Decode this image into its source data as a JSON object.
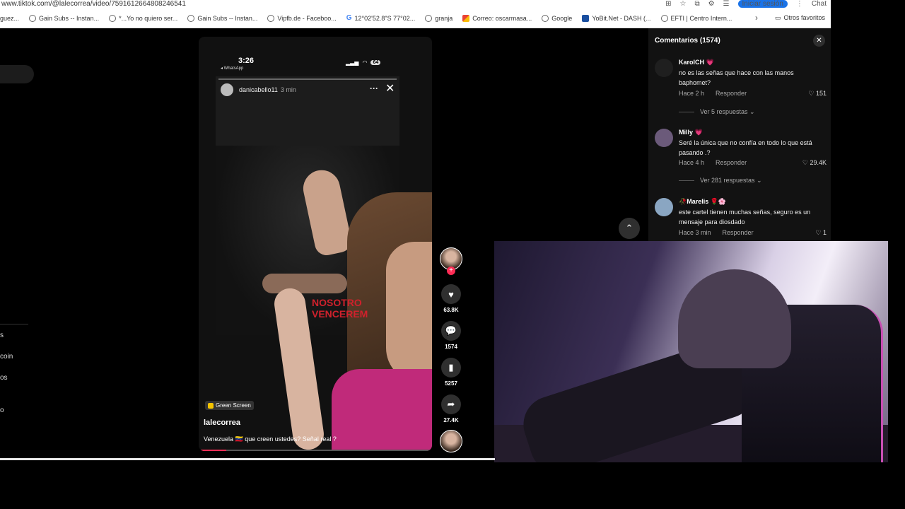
{
  "browser": {
    "url": "www.tiktok.com/@lalecorrea/video/7591612664808246541",
    "login_label": "Iniciar sesión",
    "chat_label": "Chat",
    "bookmarks": [
      {
        "label": "guez...",
        "icon": "none"
      },
      {
        "label": "Gain Subs -- Instan...",
        "icon": "globe-icon"
      },
      {
        "label": "*...Yo no quiero ser...",
        "icon": "tiktok-icon"
      },
      {
        "label": "Gain Subs -- Instan...",
        "icon": "globe-icon"
      },
      {
        "label": "Vipfb.de - Faceboo...",
        "icon": "globe-icon"
      },
      {
        "label": "12°02'52.8\"S 77°02...",
        "icon": "google-icon"
      },
      {
        "label": "granja",
        "icon": "globe-icon"
      },
      {
        "label": "Correo: oscarmasa...",
        "icon": "microsoft-icon"
      },
      {
        "label": "Google",
        "icon": "globe-icon"
      },
      {
        "label": "YoBit.Net - DASH (...",
        "icon": "yobit-icon"
      },
      {
        "label": "EFTI | Centro Intern...",
        "icon": "globe-icon"
      }
    ],
    "other_favorites": "Otros favoritos"
  },
  "sidebar": {
    "items": [
      "s",
      "coin",
      "os",
      "o"
    ]
  },
  "video": {
    "phone": {
      "time": "3:26",
      "back_app": "◂ WhatsApp",
      "battery": "64"
    },
    "story": {
      "username": "danicabello11",
      "time": "3 min",
      "overlay_text_line1": "NOSOTRO",
      "overlay_text_line2": "VENCEREM"
    },
    "effect_tag": "Green Screen",
    "author": "lalecorrea",
    "caption": "Venezuela 🇻🇪 que creen ustedes? Señal real ?",
    "progress": 0.11
  },
  "actions": {
    "likes": "63.8K",
    "comments": "1574",
    "saves": "5257",
    "shares": "27.4K",
    "follow_symbol": "+"
  },
  "comments_panel": {
    "title": "Comentarios (1574)",
    "items": [
      {
        "user": "KarolCH 💗",
        "text": "no es las señas que hace con las manos baphomet?",
        "time": "Hace 2 h",
        "reply": "Responder",
        "likes": "151",
        "more": "Ver 5 respuestas ⌄"
      },
      {
        "user": "Milly 💗",
        "text": "Seré la única que no confía en todo lo que está pasando .?",
        "time": "Hace 4 h",
        "reply": "Responder",
        "likes": "29.4K",
        "more": "Ver 281 respuestas ⌄"
      },
      {
        "user": "🥀Marelis 🌹🌸",
        "text": "este cartel tienen muchas señas, seguro es un mensaje para diosdado",
        "time": "Hace 3 min",
        "reply": "Responder",
        "likes": "1",
        "more": ""
      }
    ]
  },
  "colors": {
    "accent": "#fe2c55",
    "panel_bg": "#121212",
    "chip_bg": "#2f2f2f"
  }
}
